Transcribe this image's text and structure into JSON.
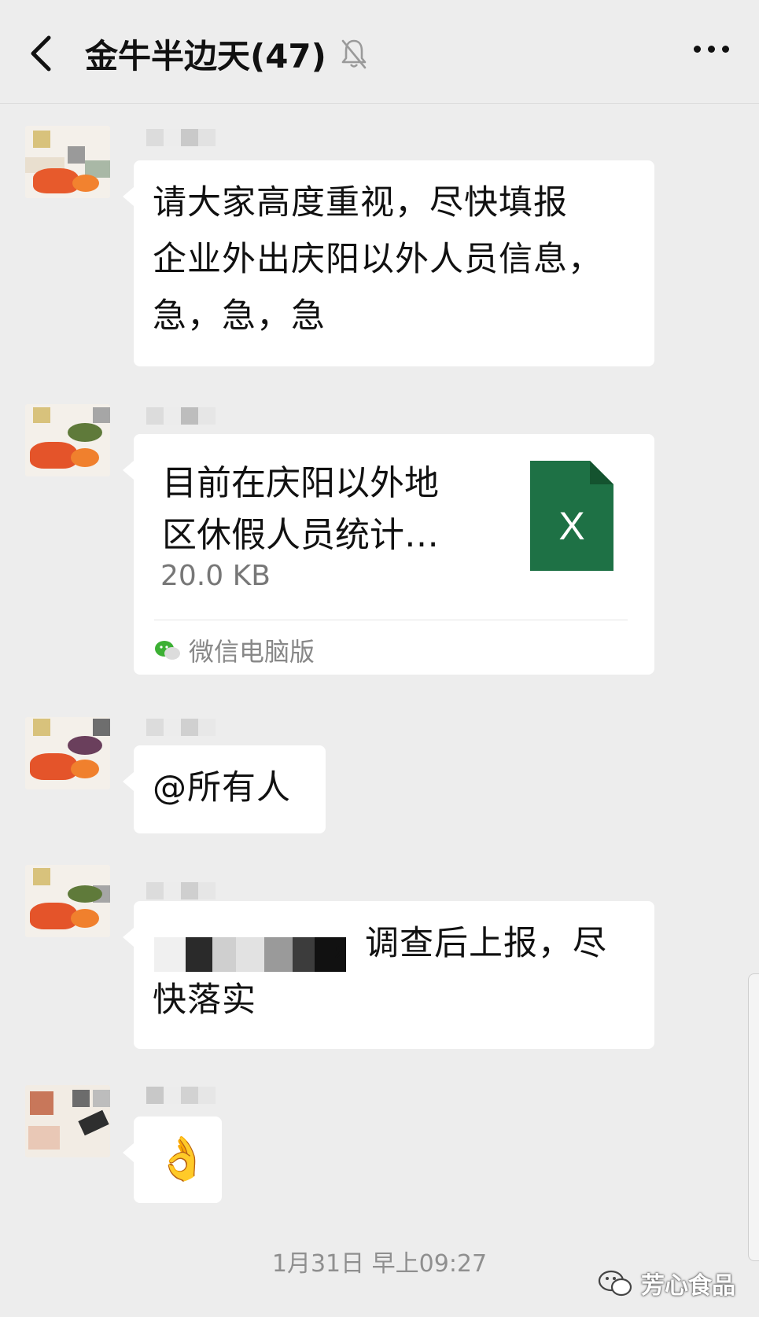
{
  "header": {
    "title": "金牛半边天(47)",
    "back_icon": "chevron-left-icon",
    "mute_icon": "bell-off-icon",
    "more_icon": "more-dots-icon"
  },
  "messages": [
    {
      "type": "text",
      "text_lines": [
        "请大家高度重视，尽快填报",
        "企业外出庆阳以外人员信息，",
        "急，急，急"
      ]
    },
    {
      "type": "file",
      "file_title_lines": [
        "目前在庆阳以外地",
        "区休假人员统计…"
      ],
      "file_size": "20.0 KB",
      "file_icon": "excel-file-icon",
      "file_icon_letter": "X",
      "source": "微信电脑版",
      "source_icon": "wechat-icon"
    },
    {
      "type": "text",
      "text_lines": [
        "@所有人"
      ]
    },
    {
      "type": "text",
      "text_lines": [
        "，调查后上报，尽",
        "快落实"
      ]
    },
    {
      "type": "emoji",
      "emoji": "👌"
    }
  ],
  "timestamp": "1月31日 早上09:27",
  "watermark": {
    "text": "芳心食品",
    "icon": "wechat-icon"
  },
  "colors": {
    "background": "#ededed",
    "bubble": "#ffffff",
    "excel_green": "#1e7145"
  }
}
